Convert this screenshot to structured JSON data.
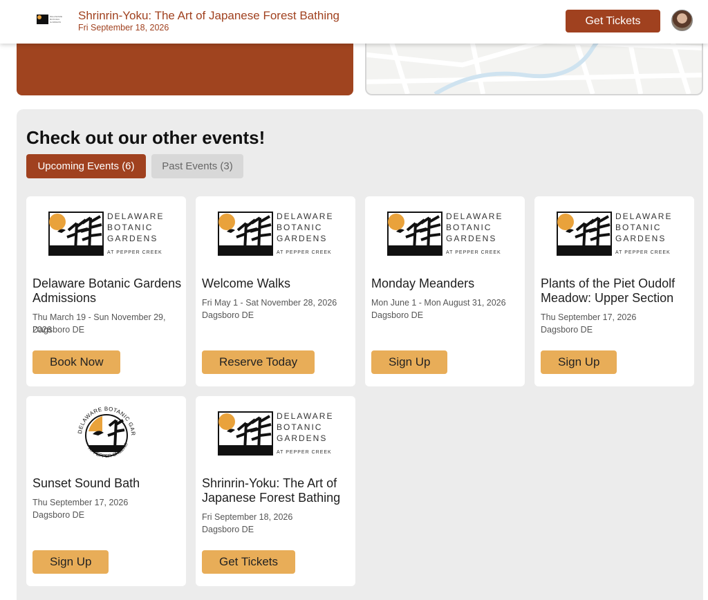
{
  "header": {
    "logo_text": [
      "DELAWARE",
      "BOTANIC",
      "GARDENS"
    ],
    "title": "Shrinrin-Yoku: The Art of Japanese Forest Bathing",
    "date": "Fri September 18, 2026",
    "cta_label": "Get Tickets"
  },
  "logo": {
    "line1": "DELAWARE",
    "line2": "BOTANIC",
    "line3": "GARDENS",
    "line4": "AT PEPPER CREEK",
    "round_top": "DELAWARE BOTANIC GARDENS",
    "round_bottom": "AT PEPPER CREEK®"
  },
  "events": {
    "title": "Check out our other events!",
    "tabs": [
      {
        "label": "Upcoming Events (6)",
        "active": true
      },
      {
        "label": "Past Events (3)",
        "active": false
      }
    ],
    "cards": [
      {
        "name": "Delaware Botanic Gardens Admissions",
        "dates": "Thu March 19 - Sun November 29, 2026",
        "location": "Dagsboro DE",
        "button": "Book Now",
        "logo": "rect"
      },
      {
        "name": "Welcome Walks",
        "dates": "Fri May 1 - Sat November 28, 2026",
        "location": "Dagsboro DE",
        "button": "Reserve Today",
        "logo": "rect"
      },
      {
        "name": "Monday Meanders",
        "dates": "Mon June 1 - Mon August 31, 2026",
        "location": "Dagsboro DE",
        "button": "Sign Up",
        "logo": "rect"
      },
      {
        "name": "Plants of the Piet Oudolf Meadow: Upper Section",
        "dates": "Thu September 17, 2026",
        "location": "Dagsboro DE",
        "button": "Sign Up",
        "logo": "rect"
      },
      {
        "name": "Sunset Sound Bath",
        "dates": "Thu September 17, 2026",
        "location": "Dagsboro DE",
        "button": "Sign Up",
        "logo": "round"
      },
      {
        "name": "Shrinrin-Yoku: The Art of Japanese Forest Bathing",
        "dates": "Fri September 18, 2026",
        "location": "Dagsboro DE",
        "button": "Get Tickets",
        "logo": "rect"
      }
    ]
  },
  "colors": {
    "brand": "#a0411f",
    "button": "#e8ad58",
    "sun": "#e9a23b"
  }
}
